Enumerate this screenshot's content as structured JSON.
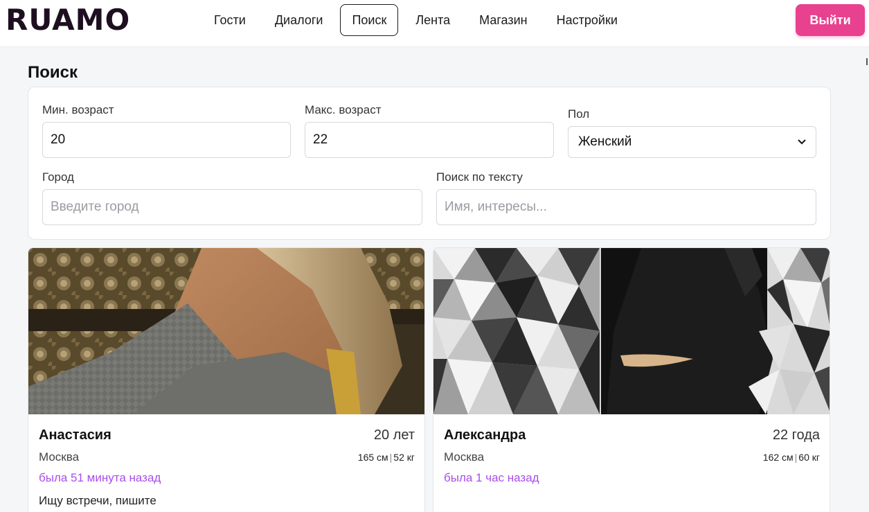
{
  "header": {
    "logo": "RUAMO",
    "nav": [
      {
        "label": "Гости"
      },
      {
        "label": "Диалоги"
      },
      {
        "label": "Поиск",
        "active": true
      },
      {
        "label": "Лента"
      },
      {
        "label": "Магазин"
      },
      {
        "label": "Настройки"
      }
    ],
    "logout_label": "Выйти"
  },
  "page": {
    "title": "Поиск"
  },
  "filters": {
    "min_age": {
      "label": "Мин. возраст",
      "value": "20"
    },
    "max_age": {
      "label": "Макс. возраст",
      "value": "22"
    },
    "gender": {
      "label": "Пол",
      "value": "Женский"
    },
    "city": {
      "label": "Город",
      "value": "",
      "placeholder": "Введите город"
    },
    "text": {
      "label": "Поиск по тексту",
      "value": "",
      "placeholder": "Имя, интересы..."
    }
  },
  "profiles": [
    {
      "name": "Анастасия",
      "age": "20 лет",
      "city": "Москва",
      "height": "165 см",
      "weight": "52 кг",
      "last_seen": "была 51 минута назад",
      "about": "Ищу встречи, пишите"
    },
    {
      "name": "Александра",
      "age": "22 года",
      "city": "Москва",
      "height": "162 см",
      "weight": "60 кг",
      "last_seen": "была 1 час назад",
      "about": ""
    }
  ],
  "colors": {
    "accent": "#e8418f",
    "last_seen": "#a94ee8",
    "logo": "#1d0f1f"
  },
  "icons": {
    "select_arrow": "chevron-down-icon"
  }
}
